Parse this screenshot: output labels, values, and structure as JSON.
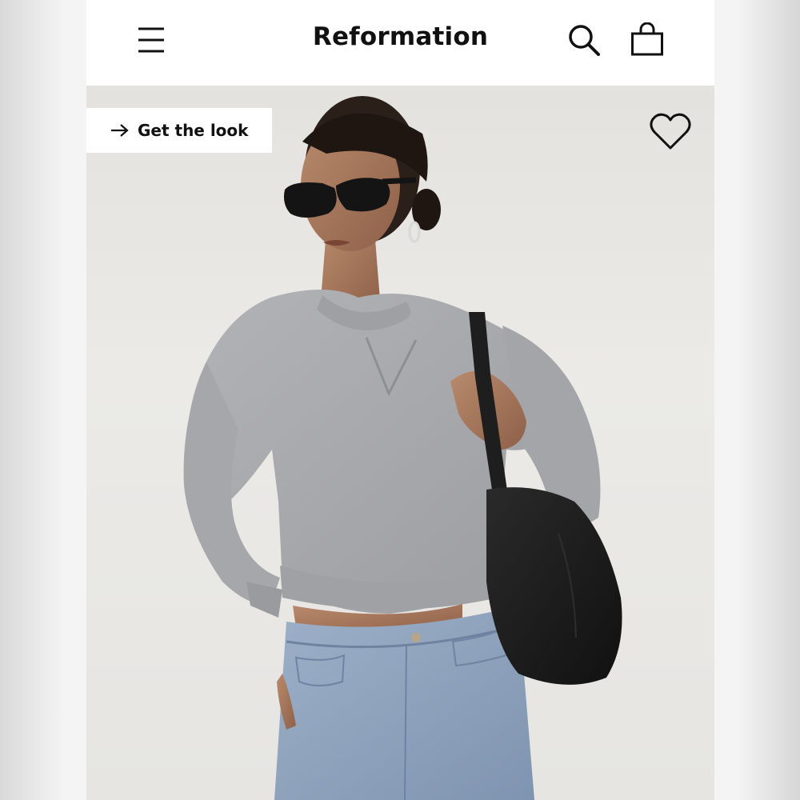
{
  "header": {
    "brand": "Reformation",
    "menu_icon": "hamburger-menu-icon",
    "search_icon": "search-icon",
    "bag_icon": "shopping-bag-icon"
  },
  "hero": {
    "cta_label": "Get the look",
    "cta_icon": "arrow-right-icon",
    "favorite_icon": "heart-outline-icon",
    "image_subject": "",
    "colors": {
      "sweater": "#a8a9ad",
      "jeans": "#8fa3bd",
      "bag": "#1c1c1c",
      "background": "#e9e8e5"
    }
  }
}
